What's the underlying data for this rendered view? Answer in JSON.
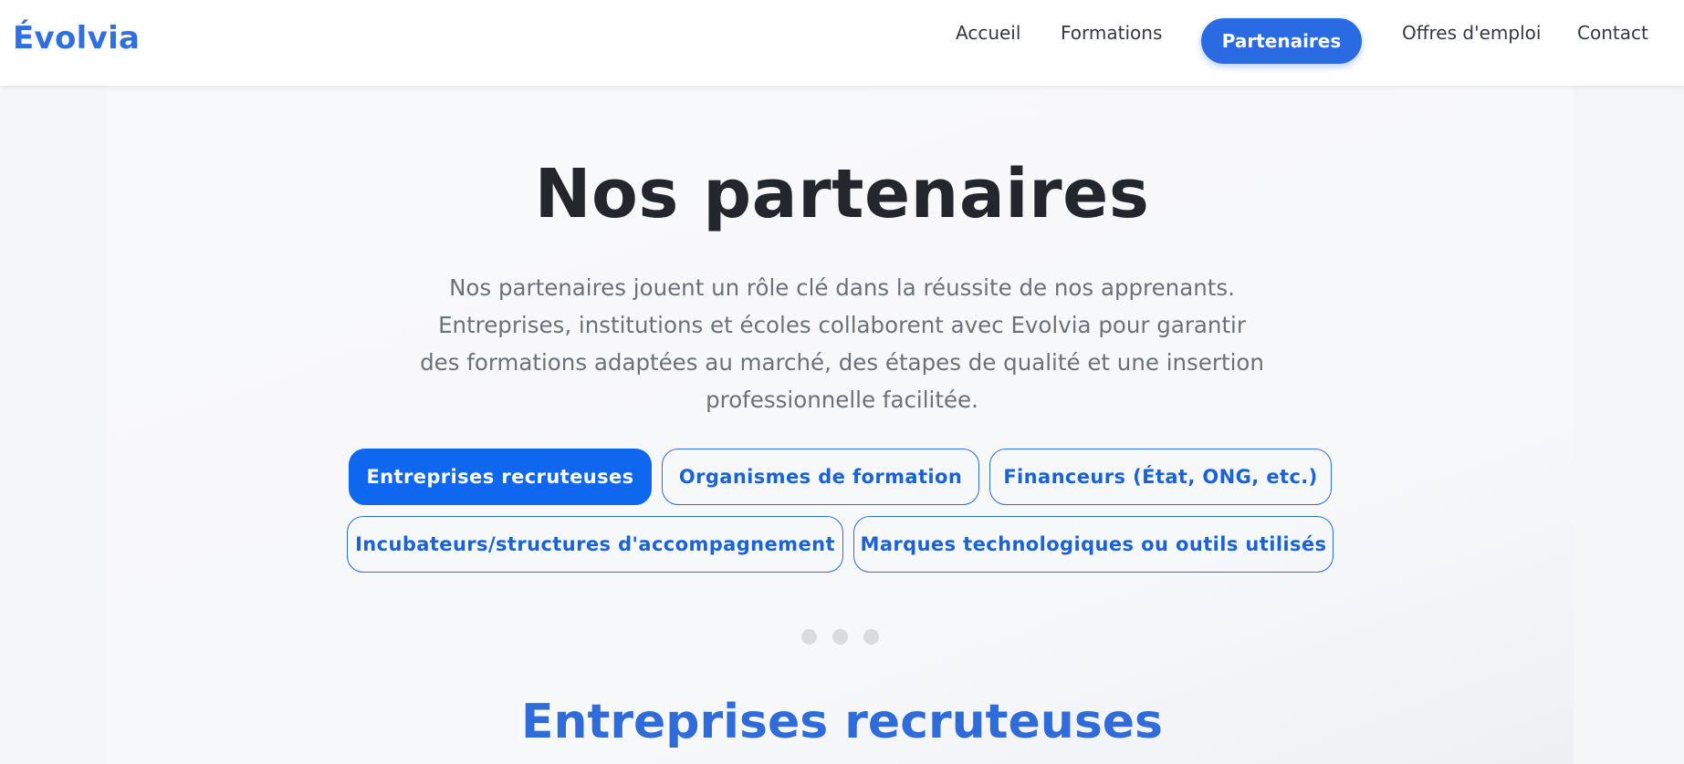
{
  "brand": {
    "name": "Évolvia",
    "color": "#2f6fe0"
  },
  "nav": {
    "items": [
      {
        "label": "Accueil",
        "active": false
      },
      {
        "label": "Formations",
        "active": false
      },
      {
        "label": "Partenaires",
        "active": true
      },
      {
        "label": "Offres d'emploi",
        "active": false
      },
      {
        "label": "Contact",
        "active": false
      }
    ]
  },
  "hero": {
    "title": "Nos partenaires",
    "description": "Nos partenaires jouent un rôle clé dans la réussite de nos apprenants. Entreprises, institutions et écoles collaborent avec Evolvia pour garantir des formations adaptées au marché, des étapes de qualité et une insertion professionnelle facilitée."
  },
  "filters": {
    "items": [
      {
        "label": "Entreprises recruteuses",
        "active": true
      },
      {
        "label": "Organismes de formation",
        "active": false
      },
      {
        "label": "Financeurs (État, ONG, etc.)",
        "active": false
      },
      {
        "label": "Incubateurs/structures d'accompagnement",
        "active": false
      },
      {
        "label": "Marques technologiques ou outils utilisés",
        "active": false
      }
    ]
  },
  "carousel": {
    "dots": 3
  },
  "section": {
    "title": "Entreprises recruteuses"
  },
  "colors": {
    "accent": "#0f67f0",
    "nav_active": "#2a6ae3",
    "title_dark": "#23272d",
    "body_text": "#6b7178",
    "section_title": "#2f6bd9"
  }
}
